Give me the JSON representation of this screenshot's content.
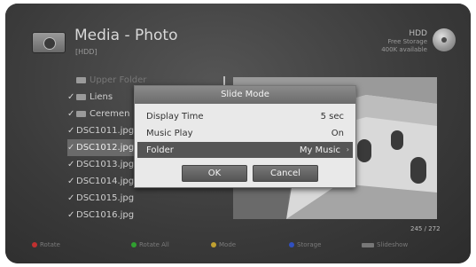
{
  "header": {
    "title": "Media - Photo",
    "subtitle": "[HDD]",
    "storage_label": "HDD",
    "storage_free_label": "Free Storage",
    "storage_free_value": "400K available"
  },
  "file_list": [
    {
      "label": "Upper Folder",
      "check": "",
      "type": "folder",
      "state": "dim"
    },
    {
      "label": "Liens",
      "check": "✓",
      "type": "folder",
      "state": "normal"
    },
    {
      "label": "Ceremen",
      "check": "✓",
      "type": "folder",
      "state": "normal"
    },
    {
      "label": "DSC1011.jpg",
      "check": "✓",
      "type": "file",
      "state": "normal"
    },
    {
      "label": "DSC1012.jpg",
      "check": "✓",
      "type": "file",
      "state": "selected"
    },
    {
      "label": "DSC1013.jpg",
      "check": "✓",
      "type": "file",
      "state": "normal"
    },
    {
      "label": "DSC1014.jpg",
      "check": "✓",
      "type": "file",
      "state": "normal"
    },
    {
      "label": "DSC1015.jpg",
      "check": "✓",
      "type": "file",
      "state": "normal"
    },
    {
      "label": "DSC1016.jpg",
      "check": "✓",
      "type": "file",
      "state": "normal"
    }
  ],
  "preview": {
    "counter_current": "245",
    "counter_total": "/ 272"
  },
  "dialog": {
    "title": "Slide Mode",
    "options": [
      {
        "label": "Display Time",
        "value": "5 sec"
      },
      {
        "label": "Music Play",
        "value": "On"
      },
      {
        "label": "Folder",
        "value": "My Music"
      }
    ],
    "ok_label": "OK",
    "cancel_label": "Cancel"
  },
  "footer": [
    {
      "label": "Rotate",
      "key_color": "#c03030",
      "kind": "dot"
    },
    {
      "label": "Rotate All",
      "key_color": "#30a030",
      "kind": "dot"
    },
    {
      "label": "Mode",
      "key_color": "#c0a030",
      "kind": "dot"
    },
    {
      "label": "Storage",
      "key_color": "#3050c0",
      "kind": "dot"
    },
    {
      "label": "Slideshow",
      "key_color": "#777777",
      "kind": "bar"
    }
  ]
}
